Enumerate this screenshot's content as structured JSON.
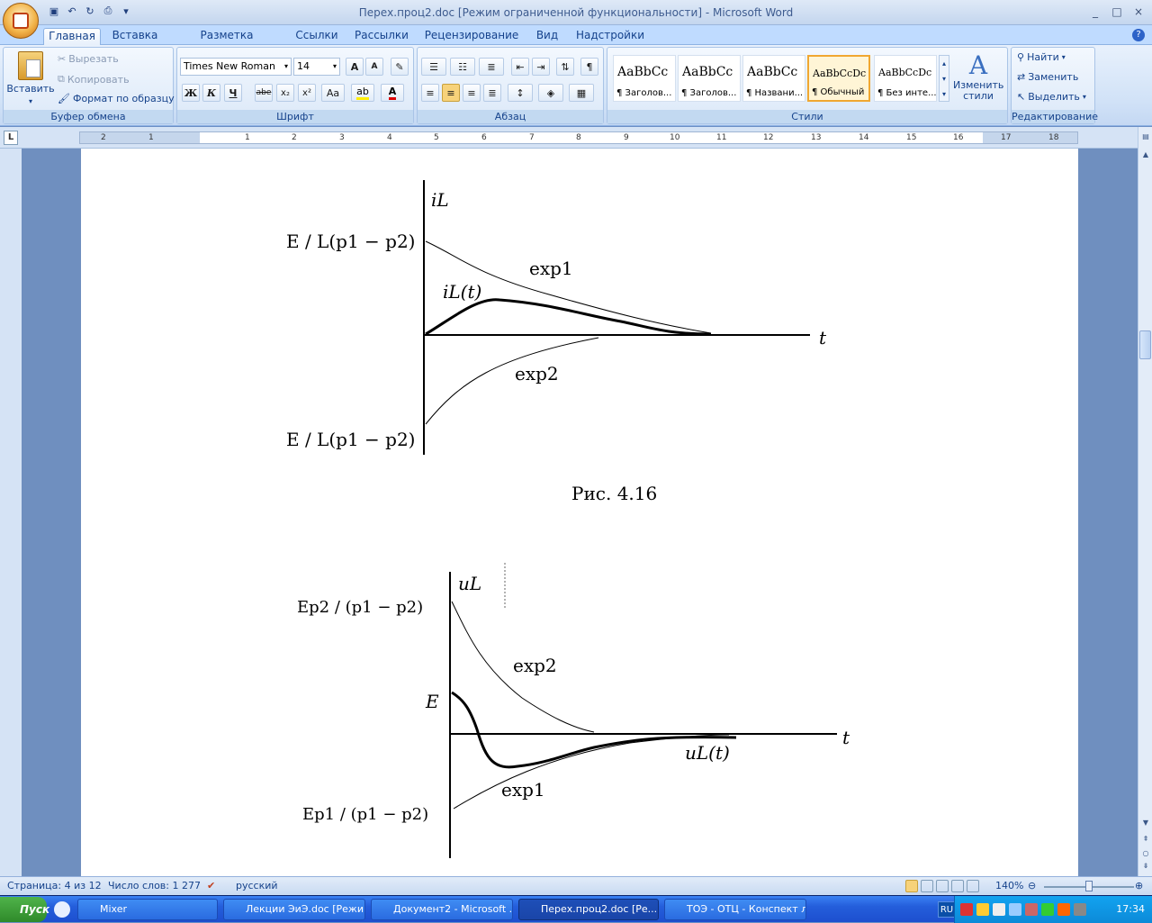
{
  "window": {
    "title": "Перех.проц2.doc [Режим ограниченной функциональности] - Microsoft Word",
    "controls": [
      "_",
      "□",
      "×"
    ]
  },
  "ribbon_tabs": [
    "Главная",
    "Вставка",
    "Разметка страницы",
    "Ссылки",
    "Рассылки",
    "Рецензирование",
    "Вид",
    "Надстройки"
  ],
  "clipboard": {
    "paste_label": "Вставить",
    "cut_label": "Вырезать",
    "copy_label": "Копировать",
    "format_painter_label": "Формат по образцу",
    "group_label": "Буфер обмена"
  },
  "font": {
    "name": "Times New Roman",
    "size": "14",
    "bold": "Ж",
    "italic": "К",
    "underline": "Ч",
    "strike": "abe",
    "sub": "x₂",
    "sup": "x²",
    "case": "Aa",
    "grow": "A",
    "shrink": "A",
    "group_label": "Шрифт"
  },
  "paragraph": {
    "group_label": "Абзац"
  },
  "styles": {
    "items": [
      {
        "sample": "AaBbCc",
        "label": "¶ Заголов..."
      },
      {
        "sample": "AaBbCc",
        "label": "¶ Заголов..."
      },
      {
        "sample": "AaBbCc",
        "label": "¶ Названи..."
      },
      {
        "sample": "AaBbCcDc",
        "label": "¶ Обычный"
      },
      {
        "sample": "AaBbCcDc",
        "label": "¶ Без инте..."
      }
    ],
    "change_label": "Изменить стили",
    "group_label": "Стили"
  },
  "editing": {
    "find_label": "Найти",
    "replace_label": "Заменить",
    "select_label": "Выделить",
    "group_label": "Редактирование"
  },
  "ruler_numbers": [
    "2",
    "1",
    "1",
    "2",
    "3",
    "4",
    "5",
    "6",
    "7",
    "8",
    "9",
    "10",
    "11",
    "12",
    "13",
    "14",
    "15",
    "16",
    "17",
    "18"
  ],
  "document": {
    "fig1": {
      "y_label": "iL",
      "x_label": "t",
      "curve_labels": [
        "exp1",
        "iL(t)",
        "exp2"
      ],
      "top_value": "E / L(p1 − p2)",
      "caption": "Рис. 4.16"
    },
    "fig2": {
      "y_label": "uL",
      "x_label": "t",
      "curve_labels": [
        "exp2",
        "exp1",
        "uL(t)"
      ],
      "e_label": "E",
      "top_value": "Ep2 / (p1 − p2)",
      "bottom_value": "Ep1 / (p1 − p2)"
    }
  },
  "status": {
    "page": "Страница: 4 из 12",
    "words": "Число слов: 1 277",
    "language": "русский",
    "zoom": "140%"
  },
  "taskbar": {
    "start": "Пуск",
    "buttons": [
      "Mixer",
      "Лекции ЭиЭ.doc [Режим...",
      "Документ2 - Microsoft ...",
      "Перех.проц2.doc [Ре...",
      "ТОЭ - ОТЦ - Конспект л..."
    ],
    "lang": "RU",
    "clock": "17:34"
  }
}
